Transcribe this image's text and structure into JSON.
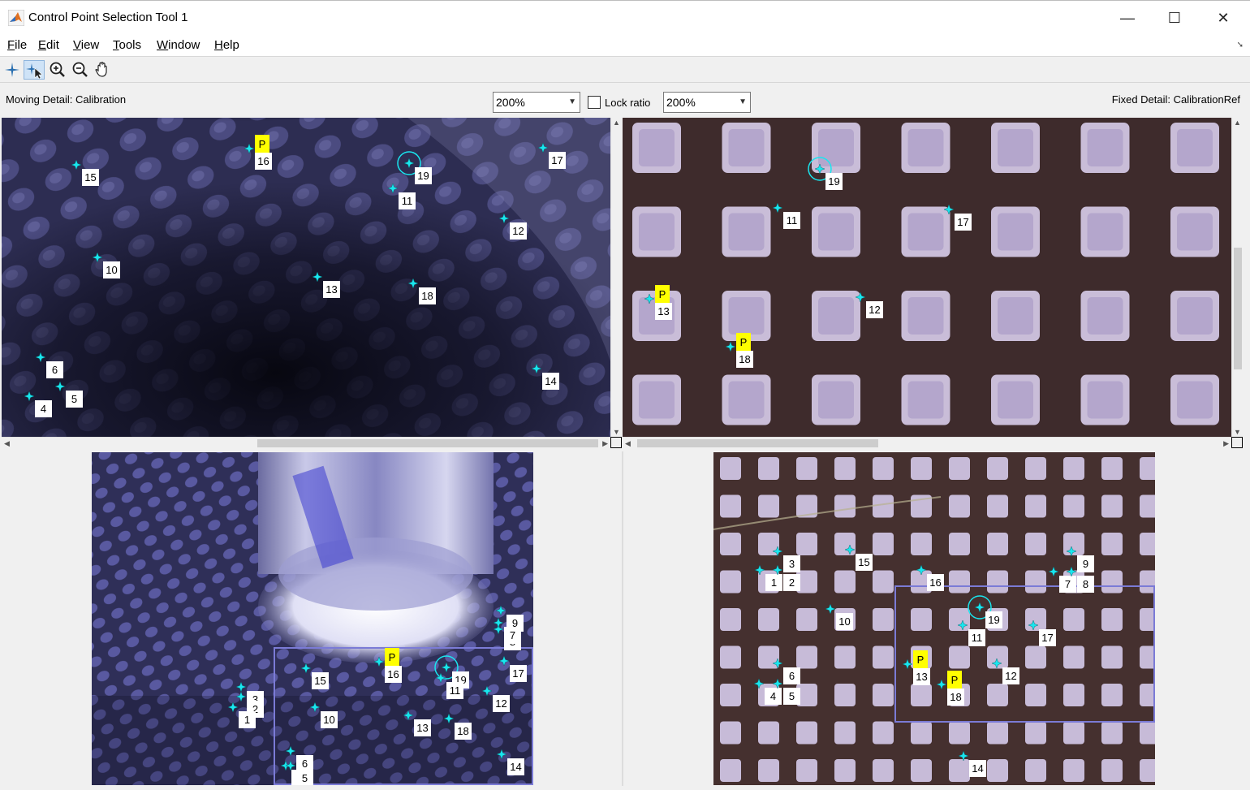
{
  "window": {
    "title": "Control Point Selection Tool 1",
    "minimize": "—",
    "maximize": "☐",
    "close": "✕"
  },
  "menu": [
    {
      "label": "File",
      "key": "F",
      "rest": "ile"
    },
    {
      "label": "Edit",
      "key": "E",
      "rest": "dit"
    },
    {
      "label": "View",
      "key": "V",
      "rest": "iew"
    },
    {
      "label": "Tools",
      "key": "T",
      "rest": "ools"
    },
    {
      "label": "Window",
      "key": "W",
      "rest": "indow"
    },
    {
      "label": "Help",
      "key": "H",
      "rest": "elp"
    }
  ],
  "toolbar": {
    "tools": [
      "add-point-icon",
      "select-move-point-icon",
      "zoom-in-icon",
      "zoom-out-icon",
      "pan-hand-icon"
    ]
  },
  "detail": {
    "moving_label": "Moving Detail: Calibration",
    "fixed_label": "Fixed Detail: CalibrationRef",
    "moving_zoom": "200%",
    "fixed_zoom": "200%",
    "lock_ratio": "Lock ratio",
    "lock_checked": false
  },
  "colors": {
    "marker": "#19e6ef",
    "predicted_badge": "#ffff00",
    "overview_rect": "#7b7bd6"
  },
  "predicted_tag": "P",
  "moving_detail_points": [
    {
      "id": "16",
      "predicted": true
    },
    {
      "id": "15"
    },
    {
      "id": "19",
      "selected": true
    },
    {
      "id": "17"
    },
    {
      "id": "11"
    },
    {
      "id": "12"
    },
    {
      "id": "10"
    },
    {
      "id": "13"
    },
    {
      "id": "18"
    },
    {
      "id": "6"
    },
    {
      "id": "5"
    },
    {
      "id": "4"
    },
    {
      "id": "14"
    }
  ],
  "fixed_detail_points": [
    {
      "id": "19",
      "selected": true
    },
    {
      "id": "11"
    },
    {
      "id": "17"
    },
    {
      "id": "13",
      "predicted": true
    },
    {
      "id": "12"
    },
    {
      "id": "18",
      "predicted": true
    }
  ],
  "moving_overview_points": [
    {
      "id": "9"
    },
    {
      "id": "8"
    },
    {
      "id": "7"
    },
    {
      "id": "16",
      "predicted": true
    },
    {
      "id": "19",
      "selected": true
    },
    {
      "id": "11"
    },
    {
      "id": "15"
    },
    {
      "id": "17"
    },
    {
      "id": "3"
    },
    {
      "id": "2"
    },
    {
      "id": "1"
    },
    {
      "id": "10"
    },
    {
      "id": "13"
    },
    {
      "id": "18"
    },
    {
      "id": "12"
    },
    {
      "id": "6"
    },
    {
      "id": "4"
    },
    {
      "id": "5"
    },
    {
      "id": "14"
    }
  ],
  "fixed_overview_points": [
    {
      "id": "3"
    },
    {
      "id": "1"
    },
    {
      "id": "2"
    },
    {
      "id": "15"
    },
    {
      "id": "16"
    },
    {
      "id": "9"
    },
    {
      "id": "7"
    },
    {
      "id": "8"
    },
    {
      "id": "10"
    },
    {
      "id": "19",
      "selected": true
    },
    {
      "id": "11"
    },
    {
      "id": "17"
    },
    {
      "id": "13",
      "predicted": true
    },
    {
      "id": "12"
    },
    {
      "id": "18",
      "predicted": true
    },
    {
      "id": "6"
    },
    {
      "id": "4"
    },
    {
      "id": "5"
    },
    {
      "id": "14"
    }
  ]
}
